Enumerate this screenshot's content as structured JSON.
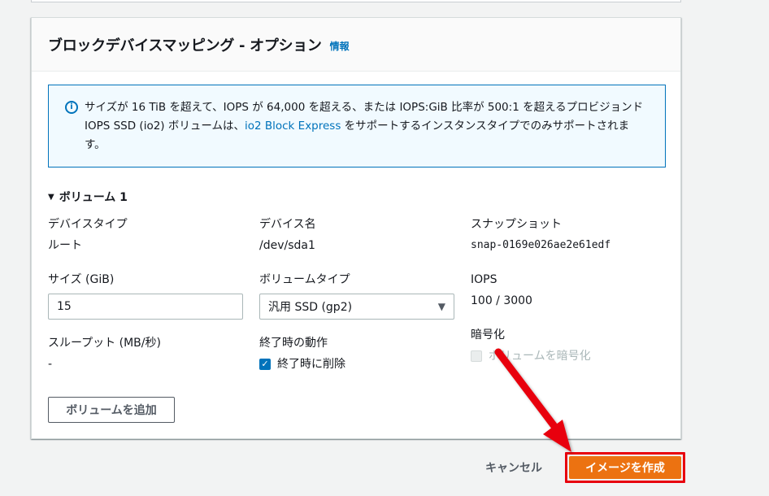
{
  "section": {
    "title": "ブロックデバイスマッピング - オプション",
    "info_link": "情報"
  },
  "alert": {
    "text_before": "サイズが 16 TiB を超えて、IOPS が 64,000 を超える、または IOPS:GiB 比率が 500:1 を超えるプロビジョンド IOPS SSD (io2) ボリュームは、",
    "link": "io2 Block Express",
    "text_after": " をサポートするインスタンスタイプでのみサポートされます。"
  },
  "volume": {
    "header": "ボリューム 1",
    "device_type": {
      "label": "デバイスタイプ",
      "value": "ルート"
    },
    "device_name": {
      "label": "デバイス名",
      "value": "/dev/sda1"
    },
    "snapshot": {
      "label": "スナップショット",
      "value": "snap-0169e026ae2e61edf"
    },
    "size": {
      "label": "サイズ (GiB)",
      "value": "15"
    },
    "volume_type": {
      "label": "ボリュームタイプ",
      "value": "汎用 SSD (gp2)"
    },
    "iops": {
      "label": "IOPS",
      "value": "100 / 3000"
    },
    "throughput": {
      "label": "スループット (MB/秒)",
      "value": "-"
    },
    "termination": {
      "label": "終了時の動作",
      "checkbox_label": "終了時に削除",
      "checked": true
    },
    "encryption": {
      "label": "暗号化",
      "checkbox_label": "ボリュームを暗号化",
      "checked": false,
      "disabled": true
    }
  },
  "buttons": {
    "add_volume": "ボリュームを追加",
    "cancel": "キャンセル",
    "create_image": "イメージを作成"
  },
  "colors": {
    "primary_button": "#ec7211",
    "link": "#0073bb",
    "annotation": "#e8000d"
  }
}
